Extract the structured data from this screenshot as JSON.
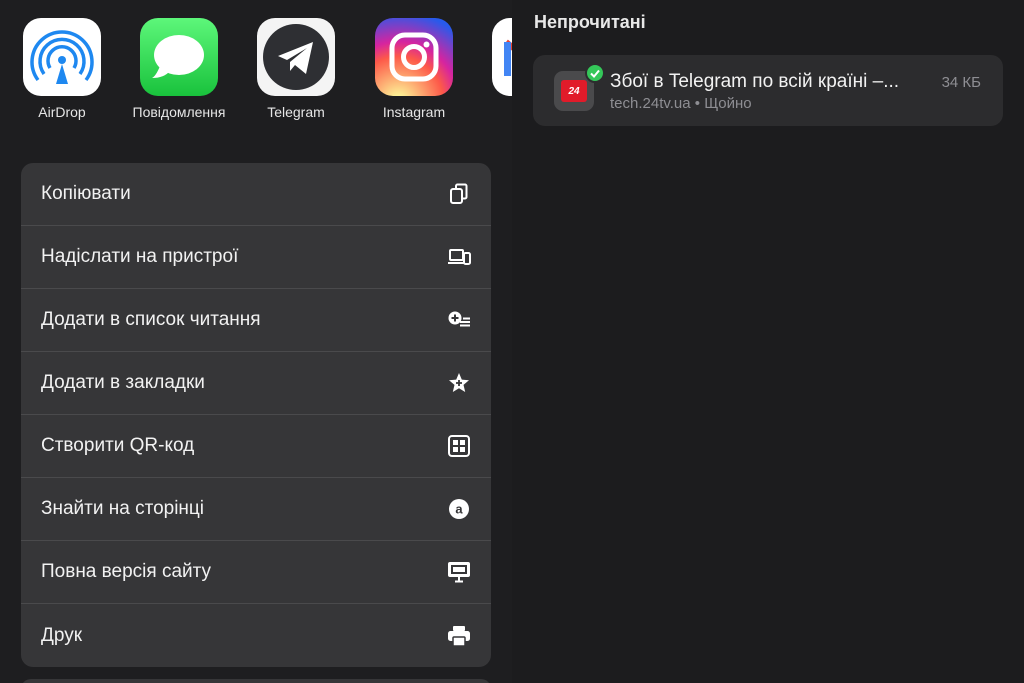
{
  "share_sheet": {
    "apps": [
      {
        "label": "AirDrop",
        "icon": "airdrop-icon"
      },
      {
        "label": "Повідомлення",
        "icon": "messages-icon"
      },
      {
        "label": "Telegram",
        "icon": "telegram-icon"
      },
      {
        "label": "Instagram",
        "icon": "instagram-icon"
      },
      {
        "label": "",
        "icon": "gmail-icon"
      }
    ],
    "actions": [
      {
        "label": "Копіювати",
        "icon": "copy-icon"
      },
      {
        "label": "Надіслати на пристрої",
        "icon": "devices-icon"
      },
      {
        "label": "Додати в список читання",
        "icon": "reading-list-icon"
      },
      {
        "label": "Додати в закладки",
        "icon": "bookmark-star-icon"
      },
      {
        "label": "Створити QR-код",
        "icon": "qr-code-icon"
      },
      {
        "label": "Знайти на сторінці",
        "icon": "find-on-page-icon"
      },
      {
        "label": "Повна версія сайту",
        "icon": "desktop-site-icon"
      },
      {
        "label": "Друк",
        "icon": "print-icon"
      }
    ]
  },
  "reading_list": {
    "section_title": "Непрочитані",
    "item": {
      "title": "Збої в Telegram по всій країні –...",
      "size": "34 КБ",
      "domain": "tech.24tv.ua",
      "separator": "•",
      "time": "Щойно",
      "favicon_text": "24"
    }
  },
  "colors": {
    "background": "#1c1c1e",
    "action_panel": "#363638",
    "card": "#2c2c2e",
    "check_green": "#34c759"
  }
}
